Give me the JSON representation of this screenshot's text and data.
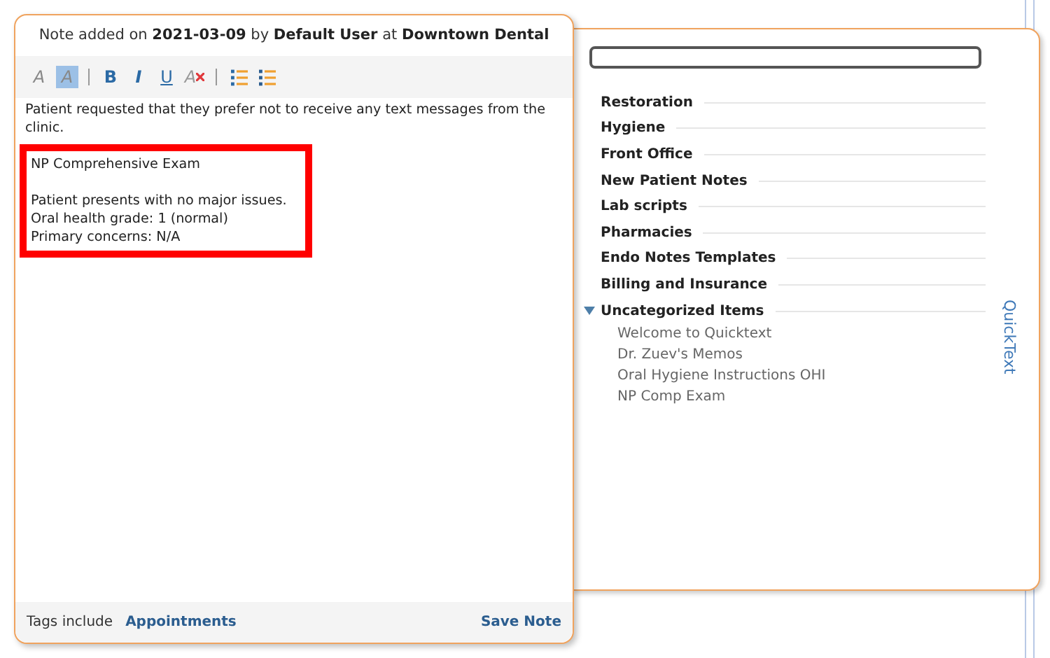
{
  "note": {
    "header": {
      "prefix": "Note added on",
      "date": "2021-03-09",
      "by": "by",
      "user": "Default User",
      "at": "at",
      "location": "Downtown Dental"
    },
    "toolbar": [
      {
        "kind": "font-color",
        "label": "A",
        "selected": false
      },
      {
        "kind": "highlight",
        "label": "A",
        "selected": true
      },
      {
        "kind": "separator"
      },
      {
        "kind": "bold",
        "label": "B",
        "selected": false
      },
      {
        "kind": "italic",
        "label": "I",
        "selected": false
      },
      {
        "kind": "underline",
        "label": "U",
        "selected": false
      },
      {
        "kind": "clear-format",
        "label": "A",
        "selected": false
      },
      {
        "kind": "separator"
      },
      {
        "kind": "numbered-list",
        "selected": false
      },
      {
        "kind": "bullet-list",
        "selected": false
      }
    ],
    "body": "Patient requested that they prefer not to receive any text messages from the clinic.",
    "highlighted_block": [
      [
        "NP Comprehensive Exam"
      ],
      [
        "Patient presents with no major issues.",
        "Oral health grade: 1 (normal)",
        "Primary concerns: N/A"
      ]
    ],
    "footer": {
      "tags_label": "Tags include",
      "tag": "Appointments",
      "save": "Save Note"
    }
  },
  "quicktext": {
    "tab": "QuickText",
    "categories": [
      {
        "label": "Restoration",
        "expanded": false
      },
      {
        "label": "Hygiene",
        "expanded": false
      },
      {
        "label": "Front Office",
        "expanded": false
      },
      {
        "label": "New Patient Notes",
        "expanded": false
      },
      {
        "label": "Lab scripts",
        "expanded": false
      },
      {
        "label": "Pharmacies",
        "expanded": false
      },
      {
        "label": "Endo Notes Templates",
        "expanded": false
      },
      {
        "label": "Billing and Insurance",
        "expanded": false
      },
      {
        "label": "Uncategorized Items",
        "expanded": true,
        "children": [
          {
            "label": "Welcome to Quicktext"
          },
          {
            "label": "Dr. Zuev's Memos"
          },
          {
            "label": "Oral Hygiene Instructions OHI"
          },
          {
            "label": "NP Comp Exam"
          }
        ]
      }
    ]
  }
}
